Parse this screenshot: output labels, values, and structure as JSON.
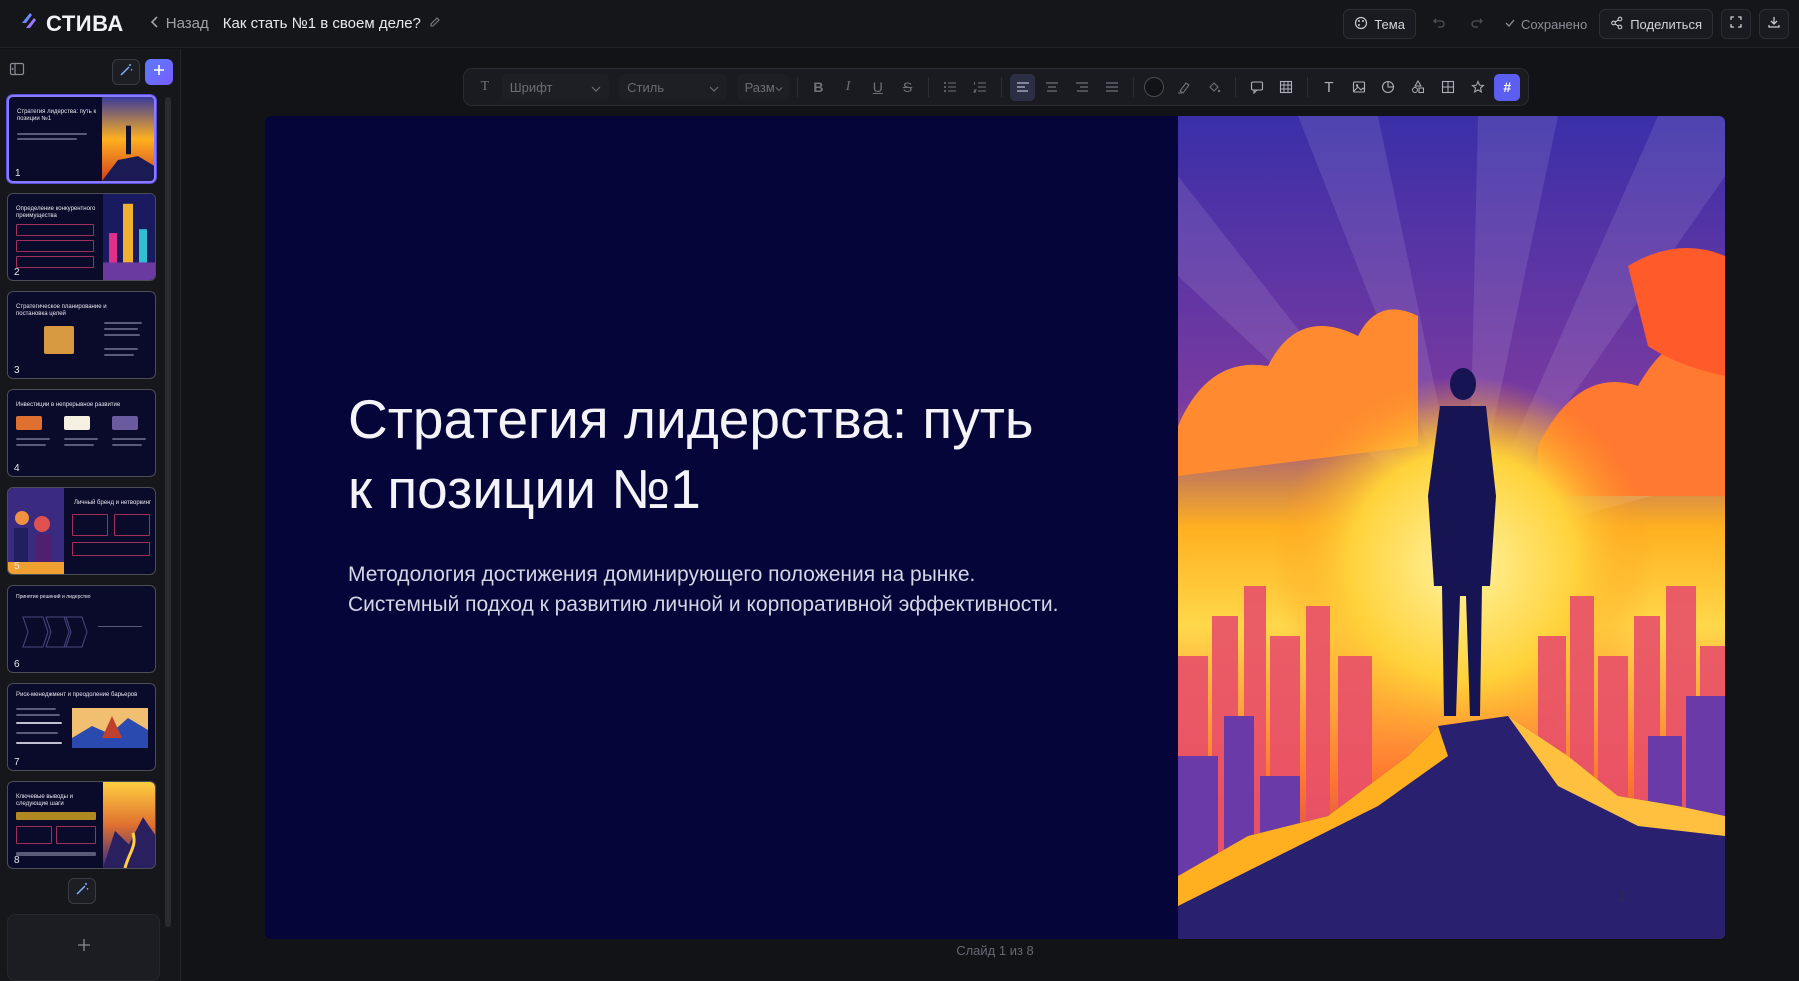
{
  "app": {
    "logo_text": "СТИВА",
    "back_label": "Назад",
    "document_title": "Как стать №1 в своем деле?",
    "theme_label": "Тема",
    "saved_label": "Сохранено",
    "share_label": "Поделиться"
  },
  "toolbar": {
    "font_placeholder": "Шрифт",
    "style_placeholder": "Стиль",
    "size_placeholder": "Разм"
  },
  "slide": {
    "title": "Стратегия лидерства: путь к позиции №1",
    "subtitle": "Методология достижения доминирующего положения на рынке. Системный подход к развитию личной и корпоративной эффективности.",
    "page_number": "1",
    "counter": "Слайд 1 из 8"
  },
  "thumbnails": [
    {
      "number": "1",
      "title": "Стратегия лидерства: путь к позиции №1"
    },
    {
      "number": "2",
      "title": "Определение конкурентного преимущества"
    },
    {
      "number": "3",
      "title": "Стратегическое планирование и постановка целей"
    },
    {
      "number": "4",
      "title": "Инвестиции в непрерывное развитие"
    },
    {
      "number": "5",
      "title": "Личный бренд и нетворкинг"
    },
    {
      "number": "6",
      "title": "Принятие решений и лидерство"
    },
    {
      "number": "7",
      "title": "Риск-менеджмент и преодоление барьеров"
    },
    {
      "number": "8",
      "title": "Ключевые выводы и следующие шаги"
    }
  ],
  "colors": {
    "accent": "#6b5cff",
    "slide_bg": "#05053a",
    "app_bg": "#121317"
  },
  "icons": [
    "logo-icon",
    "chevron-left-icon",
    "pencil-icon",
    "palette-icon",
    "undo-icon",
    "redo-icon",
    "check-icon",
    "share-icon",
    "fullscreen-icon",
    "download-icon",
    "sidebar-collapse-icon",
    "magic-wand-icon",
    "plus-icon"
  ]
}
